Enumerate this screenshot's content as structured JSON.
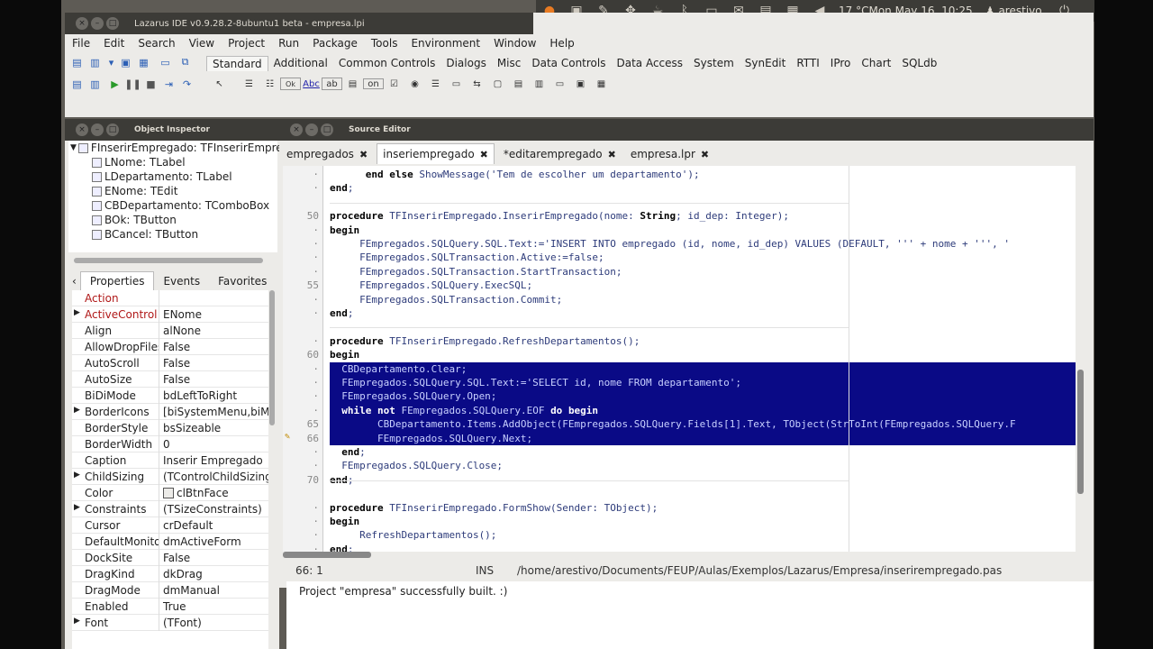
{
  "panel": {
    "weather": "17 °C",
    "clock": "Mon May 16, 10:25",
    "user": "arestivo",
    "icons": [
      "firefox-icon",
      "picture-icon",
      "pen-icon",
      "puzzle-icon",
      "cup-icon",
      "bluetooth-icon",
      "battery-icon",
      "display-icon",
      "monitor-icon",
      "document-icon",
      "volume-icon",
      "power-icon"
    ]
  },
  "ide": {
    "title": "Lazarus IDE v0.9.28.2-8ubuntu1 beta - empresa.lpi",
    "menu": [
      "File",
      "Edit",
      "Search",
      "View",
      "Project",
      "Run",
      "Package",
      "Tools",
      "Environment",
      "Window",
      "Help"
    ],
    "palette_tabs": [
      "Standard",
      "Additional",
      "Common Controls",
      "Dialogs",
      "Misc",
      "Data Controls",
      "Data Access",
      "System",
      "SynEdit",
      "RTTI",
      "IPro",
      "Chart",
      "SQLdb"
    ],
    "component_icons": [
      "cursor",
      "TMainMenu",
      "TPopupMenu",
      "TButton",
      "TLabel",
      "TEdit",
      "TMemo",
      "TToggleBox",
      "TCheckBox",
      "TRadioButton",
      "TListBox",
      "TComboBox",
      "TScrollBar",
      "TGroupBox",
      "TRadioGroup",
      "TCheckGroup",
      "TPanel",
      "TFrame",
      "TActionList"
    ],
    "component_glyphs": {
      "TButton": "Ok",
      "TLabel": "Abc",
      "TEdit": "ab"
    }
  },
  "inspector": {
    "title": "Object Inspector",
    "tree": [
      "FInserirEmpregado: TFInserirEmpregado",
      "LNome: TLabel",
      "LDepartamento: TLabel",
      "ENome: TEdit",
      "CBDepartamento: TComboBox",
      "BOk: TButton",
      "BCancel: TButton"
    ],
    "tabs": [
      "Properties",
      "Events",
      "Favorites"
    ],
    "props": [
      {
        "name": "Action",
        "value": "",
        "red": true,
        "exp": false
      },
      {
        "name": "ActiveControl",
        "value": "ENome",
        "red": true,
        "exp": true
      },
      {
        "name": "Align",
        "value": "alNone",
        "red": false,
        "exp": false
      },
      {
        "name": "AllowDropFiles",
        "value": "False",
        "red": false,
        "exp": false
      },
      {
        "name": "AutoScroll",
        "value": "False",
        "red": false,
        "exp": false
      },
      {
        "name": "AutoSize",
        "value": "False",
        "red": false,
        "exp": false
      },
      {
        "name": "BiDiMode",
        "value": "bdLeftToRight",
        "red": false,
        "exp": false
      },
      {
        "name": "BorderIcons",
        "value": "[biSystemMenu,biMi",
        "red": false,
        "exp": true
      },
      {
        "name": "BorderStyle",
        "value": "bsSizeable",
        "red": false,
        "exp": false
      },
      {
        "name": "BorderWidth",
        "value": "0",
        "red": false,
        "exp": false
      },
      {
        "name": "Caption",
        "value": "Inserir Empregado",
        "red": false,
        "exp": false
      },
      {
        "name": "ChildSizing",
        "value": "(TControlChildSizing)",
        "red": false,
        "exp": true
      },
      {
        "name": "Color",
        "value": "clBtnFace",
        "red": false,
        "exp": false
      },
      {
        "name": "Constraints",
        "value": "(TSizeConstraints)",
        "red": false,
        "exp": true
      },
      {
        "name": "Cursor",
        "value": "crDefault",
        "red": false,
        "exp": false
      },
      {
        "name": "DefaultMonitor",
        "value": "dmActiveForm",
        "red": false,
        "exp": false
      },
      {
        "name": "DockSite",
        "value": "False",
        "red": false,
        "exp": false
      },
      {
        "name": "DragKind",
        "value": "dkDrag",
        "red": false,
        "exp": false
      },
      {
        "name": "DragMode",
        "value": "dmManual",
        "red": false,
        "exp": false
      },
      {
        "name": "Enabled",
        "value": "True",
        "red": false,
        "exp": false
      },
      {
        "name": "Font",
        "value": "(TFont)",
        "red": false,
        "exp": true
      }
    ]
  },
  "editor": {
    "title": "Source Editor",
    "tabs": [
      "empregados",
      "inseriempregado",
      "*editarempregado",
      "empresa.lpr"
    ],
    "gutter": [
      "",
      "",
      "",
      "50",
      "",
      "",
      "",
      "",
      "55",
      "",
      "",
      "",
      "",
      "60",
      "",
      "",
      "",
      "",
      "65",
      "66",
      "",
      "",
      "70",
      "",
      "",
      "",
      ""
    ],
    "lines": [
      "      end else ShowMessage('Tem de escolher um departamento');",
      "end;",
      "",
      "procedure TFInserirEmpregado.InserirEmpregado(nome: String; id_dep: Integer);",
      "begin",
      "     FEmpregados.SQLQuery.SQL.Text:='INSERT INTO empregado (id, nome, id_dep) VALUES (DEFAULT, ''' + nome + ''', '",
      "     FEmpregados.SQLTransaction.Active:=false;",
      "     FEmpregados.SQLTransaction.StartTransaction;",
      "     FEmpregados.SQLQuery.ExecSQL;",
      "     FEmpregados.SQLTransaction.Commit;",
      "end;",
      "",
      "procedure TFInserirEmpregado.RefreshDepartamentos();",
      "begin",
      "  CBDepartamento.Clear;",
      "  FEmpregados.SQLQuery.SQL.Text:='SELECT id, nome FROM departamento';",
      "  FEmpregados.SQLQuery.Open;",
      "  while not FEmpregados.SQLQuery.EOF do begin",
      "        CBDepartamento.Items.AddObject(FEmpregados.SQLQuery.Fields[1].Text, TObject(StrToInt(FEmpregados.SQLQuery.F",
      "        FEmpregados.SQLQuery.Next;",
      "  end;",
      "  FEmpregados.SQLQuery.Close;",
      "end;",
      "",
      "procedure TFInserirEmpregado.FormShow(Sender: TObject);",
      "begin",
      "     RefreshDepartamentos();",
      "end;"
    ],
    "status": {
      "pos": "66: 1",
      "mode": "INS",
      "file": "/home/arestivo/Documents/FEUP/Aulas/Exemplos/Lazarus/Empresa/inserirempregado.pas"
    },
    "message": "Project \"empresa\" successfully built. :)"
  },
  "colors": {
    "selection": "#0a0a86",
    "panel": "#3c3b37",
    "window": "#ecebe8"
  }
}
